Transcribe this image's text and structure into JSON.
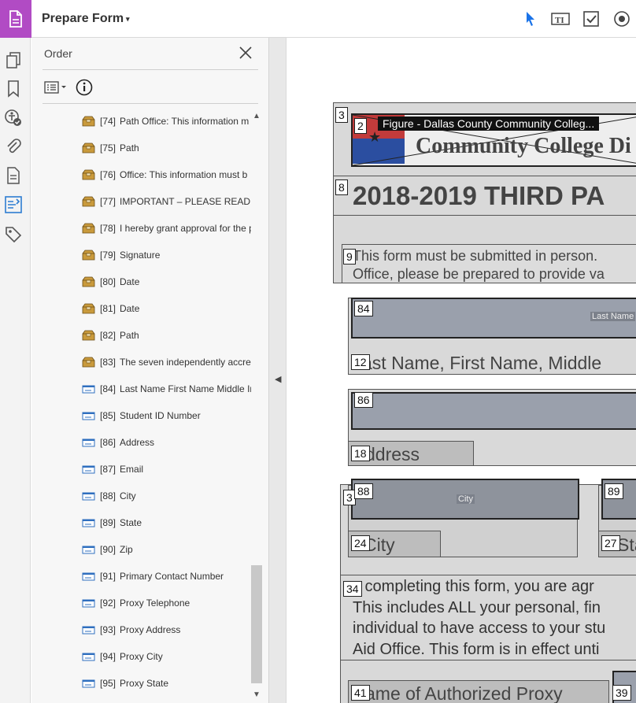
{
  "header": {
    "title": "Prepare Form",
    "caret": "▾"
  },
  "panel": {
    "title": "Order",
    "items": [
      {
        "idx": "[74]",
        "label": "Path Office:  This information m",
        "type": "tag"
      },
      {
        "idx": "[75]",
        "label": "Path",
        "type": "tag"
      },
      {
        "idx": "[76]",
        "label": "Office:  This information must b",
        "type": "tag"
      },
      {
        "idx": "[77]",
        "label": "IMPORTANT – PLEASE READ BEI",
        "type": "tag"
      },
      {
        "idx": "[78]",
        "label": "I hereby grant approval for the p",
        "type": "tag"
      },
      {
        "idx": "[79]",
        "label": "Signature",
        "type": "tag"
      },
      {
        "idx": "[80]",
        "label": "Date",
        "type": "tag"
      },
      {
        "idx": "[81]",
        "label": "Date",
        "type": "tag"
      },
      {
        "idx": "[82]",
        "label": "Path",
        "type": "tag"
      },
      {
        "idx": "[83]",
        "label": "The seven independently accrec",
        "type": "tag"
      },
      {
        "idx": "[84]",
        "label": "Last Name First Name Middle In",
        "type": "field"
      },
      {
        "idx": "[85]",
        "label": "Student ID Number",
        "type": "field"
      },
      {
        "idx": "[86]",
        "label": "Address",
        "type": "field"
      },
      {
        "idx": "[87]",
        "label": "Email",
        "type": "field"
      },
      {
        "idx": "[88]",
        "label": "City",
        "type": "field"
      },
      {
        "idx": "[89]",
        "label": "State",
        "type": "field"
      },
      {
        "idx": "[90]",
        "label": "Zip",
        "type": "field"
      },
      {
        "idx": "[91]",
        "label": "Primary Contact Number",
        "type": "field"
      },
      {
        "idx": "[92]",
        "label": "Proxy Telephone",
        "type": "field"
      },
      {
        "idx": "[93]",
        "label": "Proxy Address",
        "type": "field"
      },
      {
        "idx": "[94]",
        "label": "Proxy City",
        "type": "field"
      },
      {
        "idx": "[95]",
        "label": "Proxy State",
        "type": "field"
      }
    ]
  },
  "document": {
    "tags": {
      "t3": "3",
      "t2": "2",
      "t8": "8",
      "t9": "9",
      "t84": "84",
      "t12": "12",
      "t86": "86",
      "t18": "18",
      "t88": "88",
      "t89": "89",
      "t24": "24",
      "t27": "27",
      "t34": "34",
      "t41": "41",
      "t39": "39",
      "t3b": "3"
    },
    "figure_tooltip": "Figure - Dallas County Community Colleg...",
    "logo_text": "Community College Di",
    "heading": "2018-2019 THIRD PA",
    "intro_line1": "This form must be submitted in person.",
    "intro_line2": "Office, please be prepared to provide va",
    "field_last_name_hint": "Last Name",
    "label_last_name": "ast Name, First Name, Middle",
    "label_address": "ddress",
    "field_city_hint": "City",
    "label_city": "City",
    "label_state": "Sta",
    "para_line1": "y completing this form, you are agr",
    "para_line2": "This includes ALL your personal, fin",
    "para_line3": "individual to have access to your stu",
    "para_line4": "Aid Office. This form is in effect unti",
    "label_proxy": "ame of Authorized Proxy"
  },
  "colors": {
    "brand": "#b14bc4",
    "tool_blue": "#1a73e8",
    "form_fill": "#9aa0ac",
    "tag_bg": "#d0d0d0"
  }
}
